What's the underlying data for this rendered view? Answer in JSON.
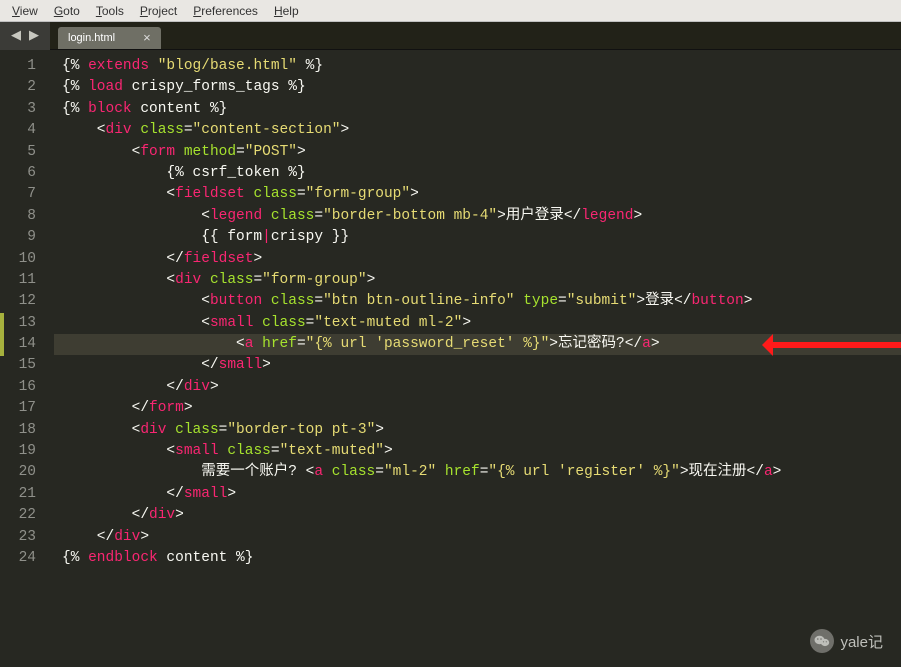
{
  "menubar": {
    "items": [
      {
        "key": "V",
        "rest": "iew"
      },
      {
        "key": "G",
        "rest": "oto"
      },
      {
        "key": "T",
        "rest": "ools"
      },
      {
        "key": "P",
        "rest": "roject"
      },
      {
        "key": "P",
        "rest": "references"
      },
      {
        "key": "H",
        "rest": "elp"
      }
    ]
  },
  "tab": {
    "label": "login.html",
    "close": "×"
  },
  "nav": {
    "back": "◀",
    "fwd": "▶"
  },
  "gutter": {
    "start": 1,
    "end": 24,
    "marks": [
      13,
      14
    ]
  },
  "code_lines": [
    [
      [
        "pu",
        "{% "
      ],
      [
        "k",
        "extends"
      ],
      [
        "pu",
        " "
      ],
      [
        "s",
        "\"blog/base.html\""
      ],
      [
        "pu",
        " %}"
      ]
    ],
    [
      [
        "pu",
        "{% "
      ],
      [
        "k",
        "load"
      ],
      [
        "txt",
        " crispy_forms_tags"
      ],
      [
        "pu",
        " %}"
      ]
    ],
    [
      [
        "pu",
        "{% "
      ],
      [
        "k",
        "block"
      ],
      [
        "txt",
        " content"
      ],
      [
        "pu",
        " %}"
      ]
    ],
    [
      [
        "pu",
        "    <"
      ],
      [
        "k",
        "div"
      ],
      [
        "pu",
        " "
      ],
      [
        "a",
        "class"
      ],
      [
        "pu",
        "="
      ],
      [
        "s",
        "\"content-section\""
      ],
      [
        "pu",
        ">"
      ]
    ],
    [
      [
        "pu",
        "        <"
      ],
      [
        "k",
        "form"
      ],
      [
        "pu",
        " "
      ],
      [
        "a",
        "method"
      ],
      [
        "pu",
        "="
      ],
      [
        "s",
        "\"POST\""
      ],
      [
        "pu",
        ">"
      ]
    ],
    [
      [
        "pu",
        "            {% "
      ],
      [
        "txt",
        "csrf_token"
      ],
      [
        "pu",
        " %}"
      ]
    ],
    [
      [
        "pu",
        "            <"
      ],
      [
        "k",
        "fieldset"
      ],
      [
        "pu",
        " "
      ],
      [
        "a",
        "class"
      ],
      [
        "pu",
        "="
      ],
      [
        "s",
        "\"form-group\""
      ],
      [
        "pu",
        ">"
      ]
    ],
    [
      [
        "pu",
        "                <"
      ],
      [
        "k",
        "legend"
      ],
      [
        "pu",
        " "
      ],
      [
        "a",
        "class"
      ],
      [
        "pu",
        "="
      ],
      [
        "s",
        "\"border-bottom mb-4\""
      ],
      [
        "pu",
        ">"
      ],
      [
        "txt",
        "用户登录"
      ],
      [
        "pu",
        "</"
      ],
      [
        "k",
        "legend"
      ],
      [
        "pu",
        ">"
      ]
    ],
    [
      [
        "pu",
        "                {{ "
      ],
      [
        "txt",
        "form"
      ],
      [
        "k",
        "|"
      ],
      [
        "txt",
        "crispy"
      ],
      [
        "pu",
        " }}"
      ]
    ],
    [
      [
        "pu",
        "            </"
      ],
      [
        "k",
        "fieldset"
      ],
      [
        "pu",
        ">"
      ]
    ],
    [
      [
        "pu",
        "            <"
      ],
      [
        "k",
        "div"
      ],
      [
        "pu",
        " "
      ],
      [
        "a",
        "class"
      ],
      [
        "pu",
        "="
      ],
      [
        "s",
        "\"form-group\""
      ],
      [
        "pu",
        ">"
      ]
    ],
    [
      [
        "pu",
        "                <"
      ],
      [
        "k",
        "button"
      ],
      [
        "pu",
        " "
      ],
      [
        "a",
        "class"
      ],
      [
        "pu",
        "="
      ],
      [
        "s",
        "\"btn btn-outline-info\""
      ],
      [
        "pu",
        " "
      ],
      [
        "a",
        "type"
      ],
      [
        "pu",
        "="
      ],
      [
        "s",
        "\"submit\""
      ],
      [
        "pu",
        ">"
      ],
      [
        "txt",
        "登录"
      ],
      [
        "pu",
        "</"
      ],
      [
        "k",
        "button"
      ],
      [
        "pu",
        ">"
      ]
    ],
    [
      [
        "pu",
        "                <"
      ],
      [
        "k",
        "small"
      ],
      [
        "pu",
        " "
      ],
      [
        "a",
        "class"
      ],
      [
        "pu",
        "="
      ],
      [
        "s",
        "\"text-muted ml-2\""
      ],
      [
        "pu",
        ">"
      ]
    ],
    [
      [
        "pu",
        "                    <"
      ],
      [
        "k",
        "a"
      ],
      [
        "pu",
        " "
      ],
      [
        "a",
        "href"
      ],
      [
        "pu",
        "="
      ],
      [
        "s",
        "\"{% url 'password_reset' %}\""
      ],
      [
        "pu",
        ">"
      ],
      [
        "txt",
        "忘记密码?"
      ],
      [
        "pu",
        "</"
      ],
      [
        "k",
        "a"
      ],
      [
        "pu",
        ">"
      ]
    ],
    [
      [
        "pu",
        "                </"
      ],
      [
        "k",
        "small"
      ],
      [
        "pu",
        ">"
      ]
    ],
    [
      [
        "pu",
        "            </"
      ],
      [
        "k",
        "div"
      ],
      [
        "pu",
        ">"
      ]
    ],
    [
      [
        "pu",
        "        </"
      ],
      [
        "k",
        "form"
      ],
      [
        "pu",
        ">"
      ]
    ],
    [
      [
        "pu",
        "        <"
      ],
      [
        "k",
        "div"
      ],
      [
        "pu",
        " "
      ],
      [
        "a",
        "class"
      ],
      [
        "pu",
        "="
      ],
      [
        "s",
        "\"border-top pt-3\""
      ],
      [
        "pu",
        ">"
      ]
    ],
    [
      [
        "pu",
        "            <"
      ],
      [
        "k",
        "small"
      ],
      [
        "pu",
        " "
      ],
      [
        "a",
        "class"
      ],
      [
        "pu",
        "="
      ],
      [
        "s",
        "\"text-muted\""
      ],
      [
        "pu",
        ">"
      ]
    ],
    [
      [
        "pu",
        "                "
      ],
      [
        "txt",
        "需要一个账户? "
      ],
      [
        "pu",
        "<"
      ],
      [
        "k",
        "a"
      ],
      [
        "pu",
        " "
      ],
      [
        "a",
        "class"
      ],
      [
        "pu",
        "="
      ],
      [
        "s",
        "\"ml-2\""
      ],
      [
        "pu",
        " "
      ],
      [
        "a",
        "href"
      ],
      [
        "pu",
        "="
      ],
      [
        "s",
        "\"{% url 'register' %}\""
      ],
      [
        "pu",
        ">"
      ],
      [
        "txt",
        "现在注册"
      ],
      [
        "pu",
        "</"
      ],
      [
        "k",
        "a"
      ],
      [
        "pu",
        ">"
      ]
    ],
    [
      [
        "pu",
        "            </"
      ],
      [
        "k",
        "small"
      ],
      [
        "pu",
        ">"
      ]
    ],
    [
      [
        "pu",
        "        </"
      ],
      [
        "k",
        "div"
      ],
      [
        "pu",
        ">"
      ]
    ],
    [
      [
        "pu",
        "    </"
      ],
      [
        "k",
        "div"
      ],
      [
        "pu",
        ">"
      ]
    ],
    [
      [
        "pu",
        "{% "
      ],
      [
        "k",
        "endblock"
      ],
      [
        "txt",
        " content"
      ],
      [
        "pu",
        " %}"
      ]
    ]
  ],
  "highlight_line": 14,
  "watermark": {
    "text": "yale记"
  }
}
